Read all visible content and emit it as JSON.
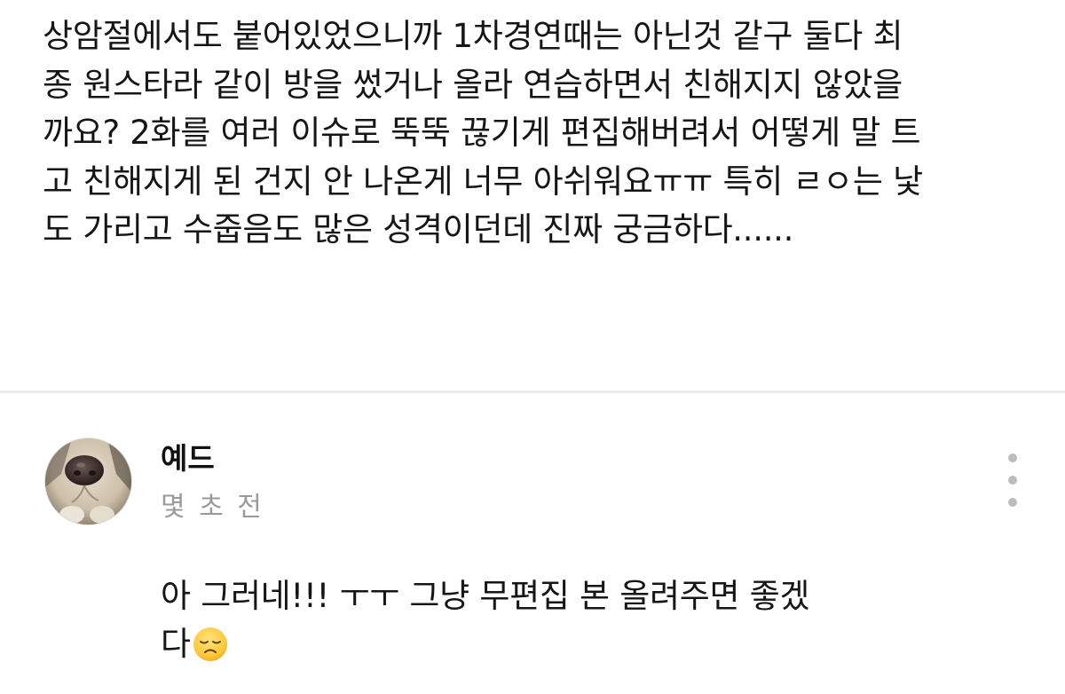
{
  "post": {
    "lines": [
      "상암절에서도 붙어있었으니까 1차경연때는 아닌것 같구 둘다 최",
      "종 원스타라 같이 방을 썼거나 올라 연습하면서 친해지지 않았을",
      "까요? 2화를 여러 이슈로 뚝뚝 끊기게 편집해버려서 어떻게 말 트",
      "고 친해지게 된 건지 안 나온게 너무 아쉬워요ㅠㅠ 특히 ㄹㅇ는 낯",
      "도 가리고 수줍음도 많은 성격이던데 진짜 궁금하다......"
    ]
  },
  "comment": {
    "author": "예드",
    "time": "몇 초 전",
    "lines": [
      "아 그러네!!! ㅜㅜ 그냥 무편집 본 올려주면 좋겠",
      "다"
    ],
    "emoji": "disappointed-face",
    "more_icon": "more-vertical-icon"
  },
  "colors": {
    "text": "#161616",
    "muted": "#9a9a9a",
    "divider": "#ececec",
    "dots": "#bcbcbc"
  }
}
